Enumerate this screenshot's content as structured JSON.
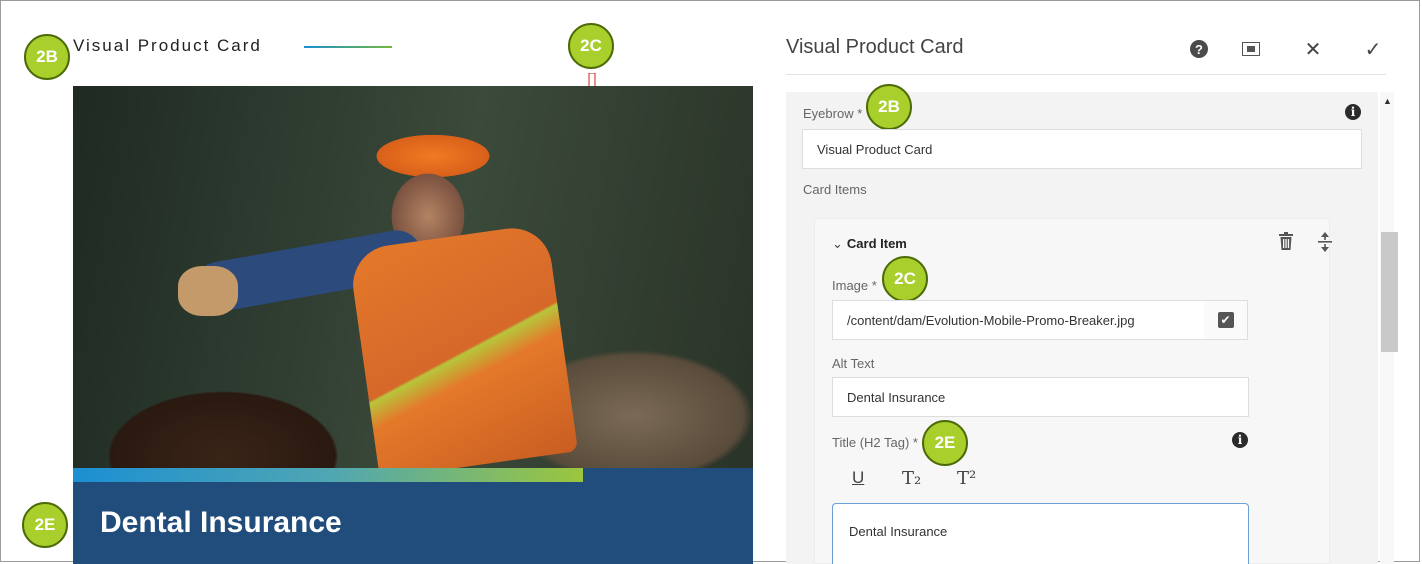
{
  "preview": {
    "eyebrow": "Visual Product Card",
    "card_title": "Dental Insurance"
  },
  "badges": {
    "b2b_left": "2B",
    "b2c_top": "2C",
    "b2e_left": "2E",
    "b2b_dialog": "2B",
    "b2c_dialog": "2C",
    "b2e_dialog": "2E"
  },
  "dialog": {
    "title": "Visual Product Card",
    "toolbar": {
      "help_icon": "help-icon",
      "fullscreen_icon": "fullscreen-icon",
      "close_glyph": "✕",
      "done_glyph": "✓"
    },
    "eyebrow_label": "Eyebrow *",
    "eyebrow_value": "Visual Product Card",
    "card_items_label": "Card Items",
    "card_item": {
      "header": "Card Item",
      "image_label": "Image *",
      "image_value": "/content/dam/Evolution-Mobile-Promo-Breaker.jpg",
      "alt_label": "Alt Text",
      "alt_value": "Dental Insurance",
      "title_label": "Title (H2 Tag) *",
      "rte_underline": "U",
      "rte_subscript": "T₂",
      "rte_superscript": "T²",
      "title_value": "Dental Insurance"
    }
  },
  "colors": {
    "badge_green": "#a9cf2c",
    "title_band": "#214d7c",
    "focus_border": "#6b9fd6"
  }
}
